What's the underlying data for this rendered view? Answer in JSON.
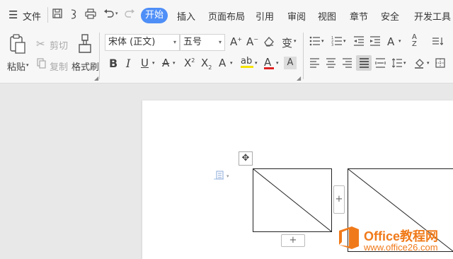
{
  "menu": {
    "file": "文件",
    "tabs": [
      "开始",
      "插入",
      "页面布局",
      "引用",
      "审阅",
      "视图",
      "章节",
      "安全",
      "开发工具"
    ]
  },
  "ribbon": {
    "paste": "粘贴",
    "cut": "剪切",
    "copy": "复制",
    "format_painter": "格式刷",
    "font_name": "宋体 (正文)",
    "font_size": "五号"
  },
  "table": {
    "add_row": "+",
    "add_column": "+",
    "move_handle": "✥"
  },
  "watermark": {
    "brand": "Office教程网",
    "url": "www.office26.com"
  },
  "colors": {
    "accent": "#4e8ef7",
    "logo_orange": "#f07a1a",
    "font_color_red": "#e02020",
    "highlight_yellow": "#f5e300"
  }
}
